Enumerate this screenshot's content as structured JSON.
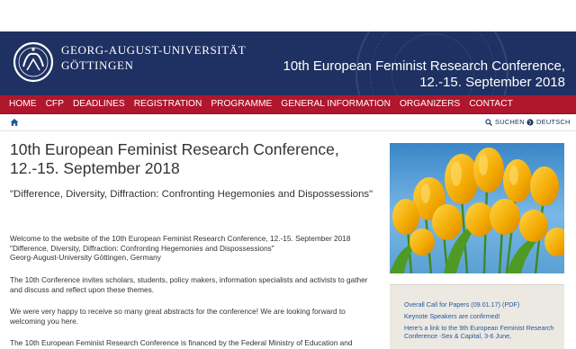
{
  "header": {
    "university_line1": "GEORG-AUGUST-UNIVERSITÄT",
    "university_line2": "GÖTTINGEN",
    "conference_title": "10th European Feminist Research Conference, 12.-15. September 2018",
    "colors": {
      "header_bg": "#1f3162",
      "nav_bg": "#b0162c"
    }
  },
  "nav": {
    "items": [
      "HOME",
      "CFP",
      "DEADLINES",
      "REGISTRATION",
      "PROGRAMME",
      "GENERAL INFORMATION",
      "ORGANIZERS",
      "CONTACT"
    ]
  },
  "utility": {
    "home_icon": "home-icon",
    "search_label": "SUCHEN",
    "language_label": "DEUTSCH"
  },
  "main": {
    "title": "10th European Feminist Research Conference, 12.-15. September 2018",
    "subtitle": "\"Difference, Diversity, Diffraction: Confronting Hegemonies and Dispossessions\"",
    "welcome_line1": "Welcome to the website of the 10th European Feminist Research Conference, 12.-15. September 2018",
    "welcome_line2": "\"Difference, Diversity, Diffraction: Confronting Hegemonies and Dispossessions\"",
    "welcome_line3": "Georg-August-University Göttingen, Germany",
    "invite_text": "The 10th Conference invites scholars, students, policy makers, information specialists and activists to gather and discuss and reflect upon these themes.",
    "abstracts_text": "We were very happy to receive so many great abstracts for the conference! We are looking forward to welcoming you here.",
    "funding_text": "The 10th European Feminist Research Conference is financed by the Federal Ministry of Education and"
  },
  "sidebar": {
    "links": [
      "Overall Call for Papers (09.01.17) (PDF)",
      "Keynote Speakers are confirmed!",
      "Here's a link to the 9th European Feminist Research Conference -Sex & Capital, 3-6 June,"
    ]
  }
}
